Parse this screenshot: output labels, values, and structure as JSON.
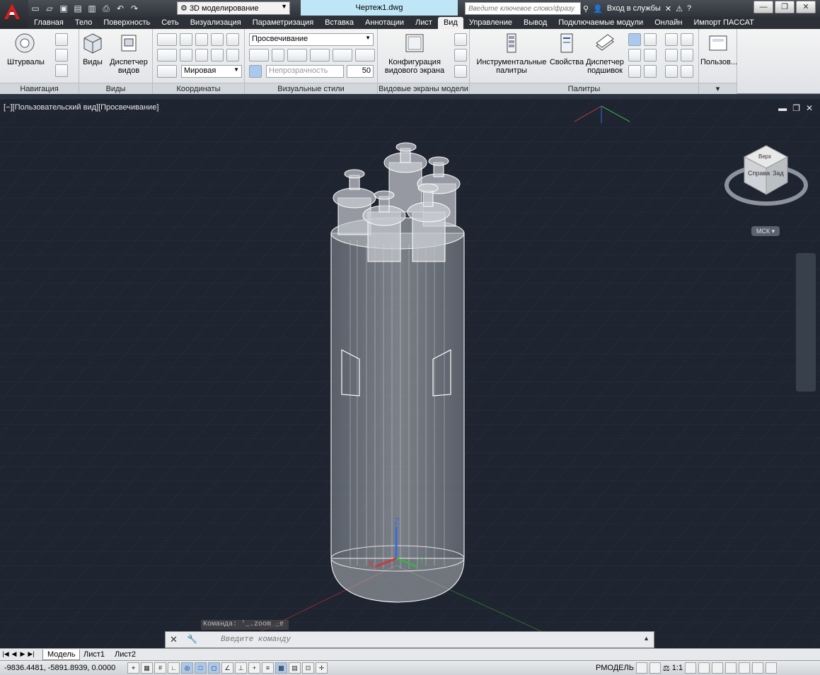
{
  "titlebar": {
    "workspace": "3D моделирование",
    "document_title": "Чертеж1.dwg",
    "search_placeholder": "Введите ключевое слово/фразу",
    "signin": "Вход в службы"
  },
  "tabs": [
    "Главная",
    "Тело",
    "Поверхность",
    "Сеть",
    "Визуализация",
    "Параметризация",
    "Вставка",
    "Аннотации",
    "Лист",
    "Вид",
    "Управление",
    "Вывод",
    "Подключаемые модули",
    "Онлайн",
    "Импорт ПАССАТ"
  ],
  "active_tab": "Вид",
  "ribbon": {
    "nav": {
      "title": "Навигация",
      "steering": "Штурвалы"
    },
    "views": {
      "title": "Виды",
      "views_btn": "Виды",
      "manager": "Диспетчер",
      "manager2": "видов"
    },
    "coords": {
      "title": "Координаты",
      "world": "Мировая"
    },
    "styles": {
      "title": "Визуальные стили",
      "style": "Просвечивание",
      "opacity_label": "Непрозрачность",
      "opacity_value": "50"
    },
    "viewports": {
      "title": "Видовые экраны модели",
      "config": "Конфигурация",
      "config2": "видового экрана"
    },
    "palettes": {
      "title": "Палитры",
      "tool": "Инструментальные",
      "tool2": "палитры",
      "props": "Свойства",
      "sheet": "Диспетчер",
      "sheet2": "подшивок"
    },
    "user": {
      "label": "Пользов..."
    }
  },
  "viewport": {
    "label": "[−][Пользовательский вид][Просвечивание]",
    "ucs": "МСК",
    "cube_face1": "Справа",
    "cube_face2": "Зад",
    "cube_top": "Верх",
    "axis_x": "X",
    "axis_y": "Y",
    "axis_z": "Z"
  },
  "command": {
    "history": "Команда: '_.zoom _e",
    "placeholder": "Введите команду"
  },
  "layouts": [
    "Модель",
    "Лист1",
    "Лист2"
  ],
  "status": {
    "coords": "-9836.4481, -5891.8939, 0.0000",
    "space": "РМОДЕЛЬ",
    "scale": "1:1"
  },
  "colors": {
    "accent": "#bfe6f7",
    "viewport_bg": "#1e2430",
    "ribbon_bg": "#e8eaed"
  }
}
